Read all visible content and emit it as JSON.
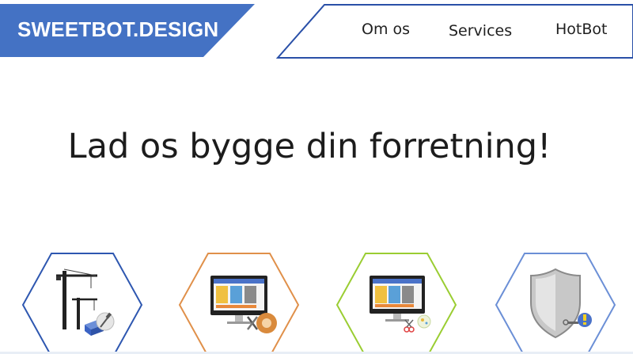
{
  "brand": {
    "name": "SWEETBOT.DESIGN",
    "color": "#4472c4"
  },
  "nav": {
    "items": [
      {
        "label": "Om os"
      },
      {
        "label": "Services"
      },
      {
        "label": "HotBot"
      }
    ],
    "border_color": "#2a50a8"
  },
  "hero": {
    "title": "Lad os bygge din forretning!"
  },
  "services": [
    {
      "icon": "construction-cranes-icon",
      "border_color": "#2e57b0"
    },
    {
      "icon": "web-design-monitor-icon",
      "border_color": "#e0904a"
    },
    {
      "icon": "web-development-monitor-icon",
      "border_color": "#9acd32"
    },
    {
      "icon": "security-shield-icon",
      "border_color": "#6b8fd6"
    }
  ]
}
